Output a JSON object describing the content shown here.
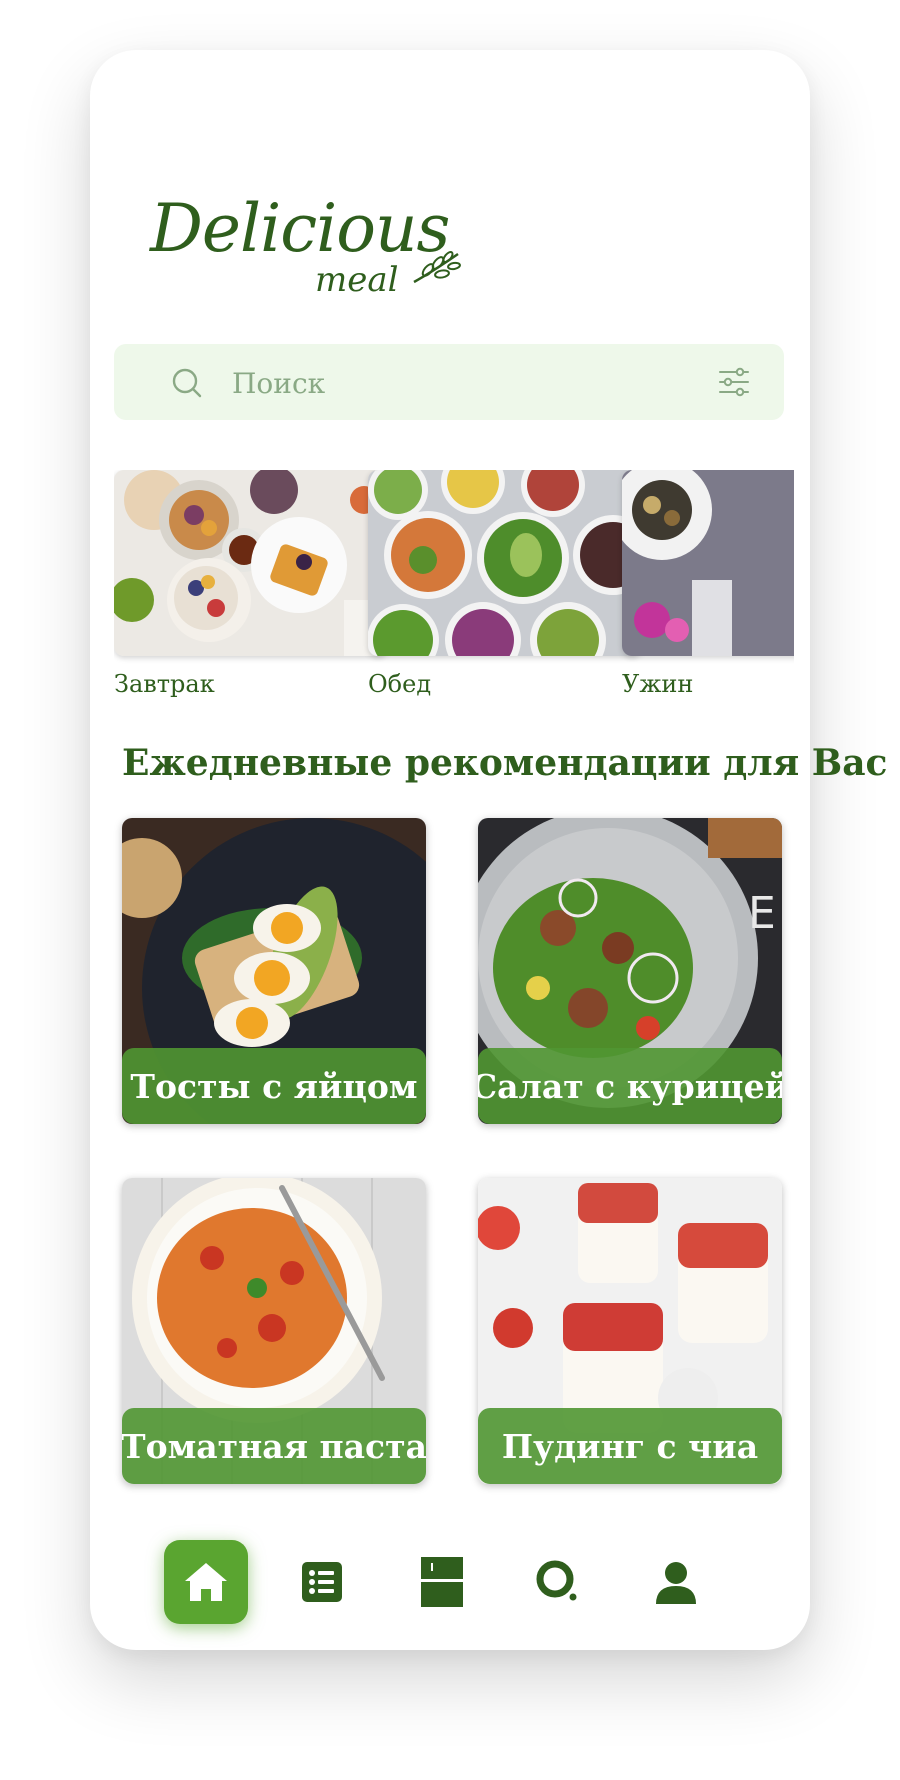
{
  "logo": {
    "word1": "Delicious",
    "word2": "meal"
  },
  "search": {
    "placeholder": "Поиск"
  },
  "categories": [
    {
      "label": "Завтрак"
    },
    {
      "label": "Обед"
    },
    {
      "label": "Ужин"
    }
  ],
  "section_title": "Ежедневные рекомендации для Вас",
  "recipes": [
    {
      "title": "Тосты с яйцом"
    },
    {
      "title": "Салат с курицей"
    },
    {
      "title": "Томатная паста"
    },
    {
      "title": "Пудинг с чиа"
    }
  ],
  "nav": {
    "items": [
      "home-icon",
      "list-icon",
      "book-icon",
      "search-icon",
      "profile-icon"
    ],
    "active": "home-icon"
  },
  "colors": {
    "brand_dark": "#2f5e1d",
    "brand_accent": "#5aa530",
    "search_bg": "#eef8ea"
  }
}
